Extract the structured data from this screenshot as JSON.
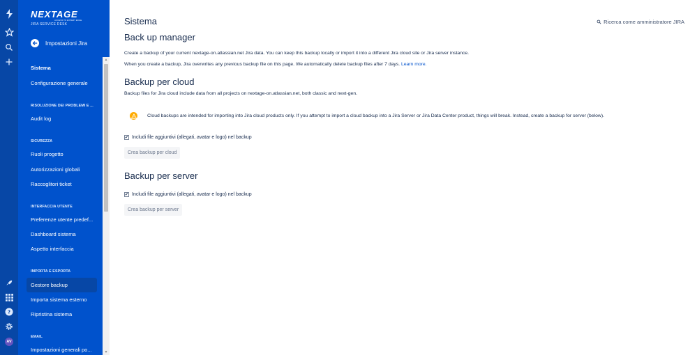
{
  "brand": {
    "logo_text": "NEXTAGE",
    "logo_tagline": "ACCESS TO EXPERT EDGE",
    "subtitle": "JIRA SERVICE DESK",
    "accent": "#0052cc",
    "rail_color": "#0747a6"
  },
  "rail": {
    "icons": [
      "jira-logo-icon",
      "star-icon",
      "search-icon",
      "plus-icon",
      "rocket-icon",
      "app-switcher-icon",
      "help-icon",
      "settings-icon"
    ],
    "avatar_initials": "AV"
  },
  "sidebar": {
    "back_label": "Impostazioni Jira",
    "items": {
      "sistema": "Sistema",
      "config": "Configurazione generale",
      "section_troubleshoot": "RISOLUZIONE DEI PROBLEMI E ...",
      "audit": "Audit log",
      "section_security": "SICUREZZA",
      "roles": "Ruoli progetto",
      "global_perms": "Autorizzazioni globali",
      "collectors": "Raccoglitori ticket",
      "section_ui": "INTERFACCIA UTENTE",
      "user_prefs": "Preferenze utente predef...",
      "dashboard": "Dashboard sistema",
      "look": "Aspetto interfaccia",
      "section_import": "IMPORTA E ESPORTA",
      "backup_manager": "Gestore backup",
      "import_external": "Importa sistema esterno",
      "restore": "Ripristina sistema",
      "section_email": "EMAIL",
      "email_general": "Impostazioni generali po..."
    }
  },
  "main": {
    "page_title": "Sistema",
    "admin_search": "Ricerca come amministratore JIRA",
    "heading": "Back up manager",
    "intro_1": "Create a backup of your current nextage-on.atlassian.net Jira data. You can keep this backup locally or import it into a different Jira cloud site or Jira server instance.",
    "intro_2": "When you create a backup, Jira overwrites any previous backup file on this page. We automatically delete backup files after 7 days.",
    "learn_more": "Learn more.",
    "cloud": {
      "heading": "Backup per cloud",
      "desc": "Backup files for Jira cloud include data from all projects on nextage-on.atlassian.net, both classic and next-gen.",
      "warning": "Cloud backups are intended for importing into Jira cloud products only. If you attempt to import a cloud backup into a Jira Server or Jira Data Center product, things will break. Instead, create a backup for server (below).",
      "checkbox_label": "Includi file aggiuntivi (allegati, avatar e logo) nel backup",
      "checked": true,
      "button": "Crea backup per cloud"
    },
    "server": {
      "heading": "Backup per server",
      "checkbox_label": "Includi file aggiuntivi (allegati, avatar e logo) nel backup",
      "checked": true,
      "button": "Crea backup per server"
    }
  }
}
